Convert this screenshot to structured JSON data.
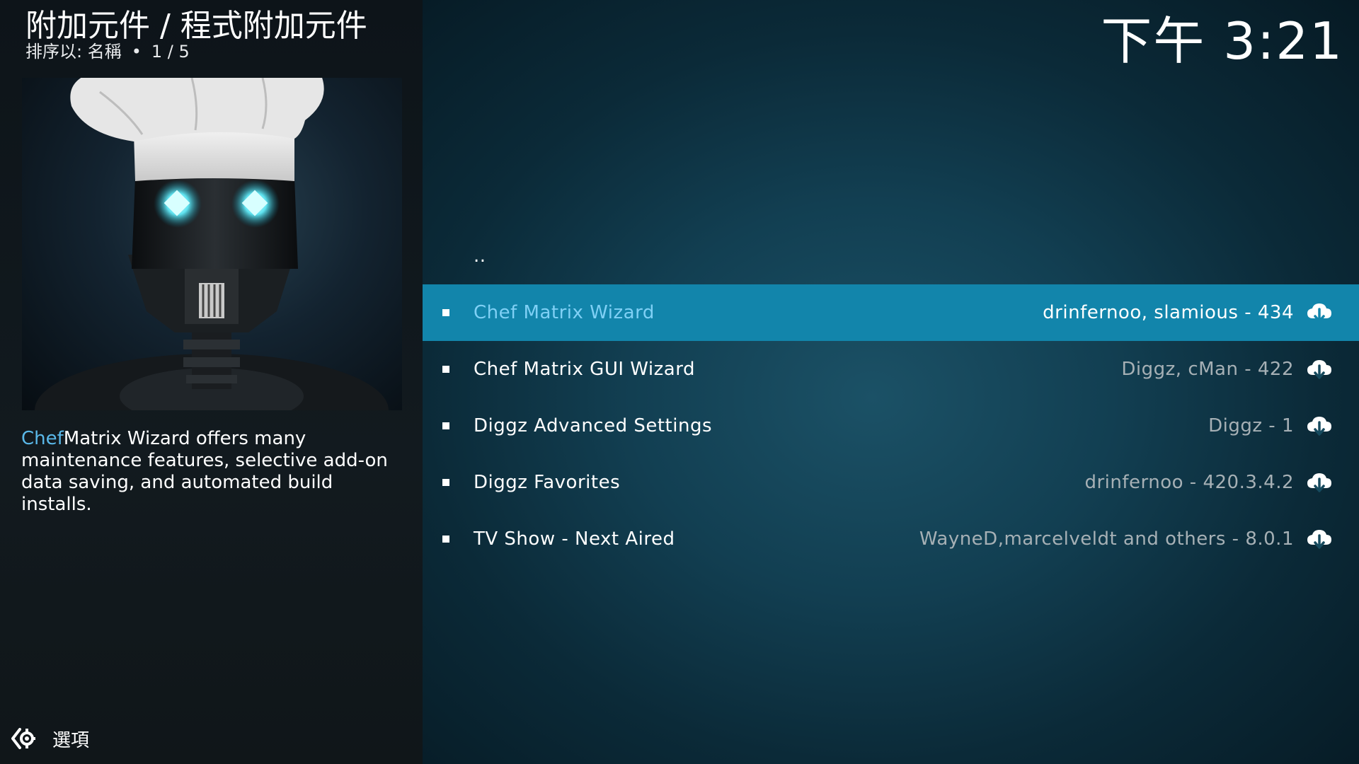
{
  "header": {
    "title": "附加元件 / 程式附加元件",
    "sort_label": "排序以: 名稱",
    "separator": "•",
    "position": "1 / 5"
  },
  "clock": "下午 3:21",
  "description": {
    "accent": "Chef",
    "text": "Matrix Wizard offers many maintenance features, selective add-on data saving, and automated build installs."
  },
  "footer": {
    "options_label": "選項"
  },
  "list": {
    "parent_label": "..",
    "items": [
      {
        "label": "Chef Matrix Wizard",
        "meta": "drinfernoo, slamious - 434",
        "icon": "cloud-download-icon",
        "focused": true
      },
      {
        "label": "Chef Matrix GUI Wizard",
        "meta": "Diggz, cMan - 422",
        "icon": "cloud-download-icon",
        "focused": false
      },
      {
        "label": "Diggz Advanced Settings",
        "meta": "Diggz - 1",
        "icon": "cloud-download-icon",
        "focused": false
      },
      {
        "label": "Diggz Favorites",
        "meta": "drinfernoo - 420.3.4.2",
        "icon": "cloud-download-icon",
        "focused": false
      },
      {
        "label": "TV Show - Next Aired",
        "meta": "WayneD,marcelveldt and others - 8.0.1",
        "icon": "cloud-download-icon",
        "focused": false
      }
    ]
  },
  "colors": {
    "focus_bg": "#1285ab",
    "focus_label": "#7fd0f5",
    "accent": "#5ab9ea",
    "meta_text": "#a6b0b5"
  }
}
